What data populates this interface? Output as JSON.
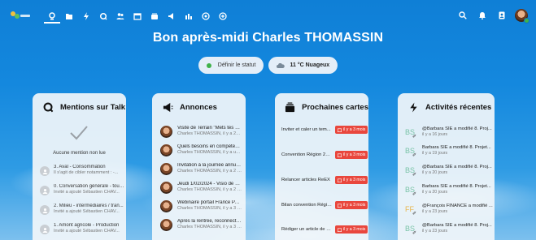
{
  "topbar": {
    "nav_icons": [
      "dashboard-icon",
      "files-icon",
      "activity-icon",
      "search-circle-icon",
      "contacts-icon",
      "calendar-icon",
      "deck-icon",
      "announcements-icon",
      "analytics-icon",
      "circles-icon",
      "more-circle-icon"
    ],
    "right_icons": [
      "search-icon",
      "notifications-icon",
      "contacts-menu-icon",
      "user-avatar"
    ]
  },
  "greeting": "Bon après-midi Charles THOMASSIN",
  "status": {
    "set_status_label": "Définir le statut",
    "weather_label": "11 °C Nuageux"
  },
  "talk": {
    "title": "Mentions sur Talk",
    "empty_text": "Aucune mention non lue",
    "items": [
      {
        "title": "3. Aval - Consommation",
        "subtitle": "Il s'agit de cibler notamment : -..."
      },
      {
        "title": "0. Conversation générale - tous...",
        "subtitle": "Invité a ajouté Sébastien CHAV..."
      },
      {
        "title": "2. Milieu - intermédiaires / tran...",
        "subtitle": "Invité a ajouté Sébastien CHAV..."
      },
      {
        "title": "1. Amont agricole - Production",
        "subtitle": "Invité a ajouté Sébastien CHAV..."
      }
    ]
  },
  "annonces": {
    "title": "Annonces",
    "items": [
      {
        "title": "Visite de Terrain \"Mets tes bott...",
        "subtitle": "Charles THOMASSIN, il y a 23 j..."
      },
      {
        "title": "Quels besoins en compétences...",
        "subtitle": "Charles THOMASSIN, il y a un ..."
      },
      {
        "title": "Invitation à la journée annuelle...",
        "subtitle": "Charles THOMASSIN, il y a 2 m..."
      },
      {
        "title": "Jeudi 1/02/2024 - Visio de pris...",
        "subtitle": "Charles THOMASSIN, il y a 2 m..."
      },
      {
        "title": "Webinaire portail France PAT : ...",
        "subtitle": "Charles THOMASSIN, il y a 3 m..."
      },
      {
        "title": "Après la rentrée, reconnecter a...",
        "subtitle": "Charles THOMASSIN, il y a 3 m..."
      }
    ]
  },
  "cartes": {
    "title": "Prochaines cartes",
    "items": [
      {
        "name": "Inviter et caler un tem...",
        "due": "il y a 3 mois"
      },
      {
        "name": "Convention Région 2024",
        "due": "il y a 3 mois"
      },
      {
        "name": "Relancer articles ReEX",
        "due": "il y a 3 mois"
      },
      {
        "name": "Bilan convention Régio...",
        "due": "il y a 3 mois"
      },
      {
        "name": "Rédiger un article de p...",
        "due": "il y a 3 mois"
      }
    ]
  },
  "activites": {
    "title": "Activités récentes",
    "items": [
      {
        "initials": "BS",
        "color": "#7bc4a8",
        "text": "@Barbara SIE a modifié 8. Proj...",
        "time": "il y a 16 jours"
      },
      {
        "initials": "BS",
        "color": "#7bc4a8",
        "text": "Barbara SIE a modifié 8. Projet...",
        "time": "il y a 19 jours"
      },
      {
        "initials": "BS",
        "color": "#7bc4a8",
        "text": "@Barbara SIE a modifié 8. Proj...",
        "time": "il y a 20 jours"
      },
      {
        "initials": "BS",
        "color": "#7bc4a8",
        "text": "Barbara SIE a modifié 8. Projet...",
        "time": "il y a 20 jours"
      },
      {
        "initials": "FF",
        "color": "#e8b44a",
        "text": "@François FINANCE a modifié ...",
        "time": "il y a 23 jours"
      },
      {
        "initials": "BS",
        "color": "#7bc4a8",
        "text": "@Barbara SIE a modifié 8. Proj...",
        "time": "il y a 23 jours"
      }
    ]
  }
}
